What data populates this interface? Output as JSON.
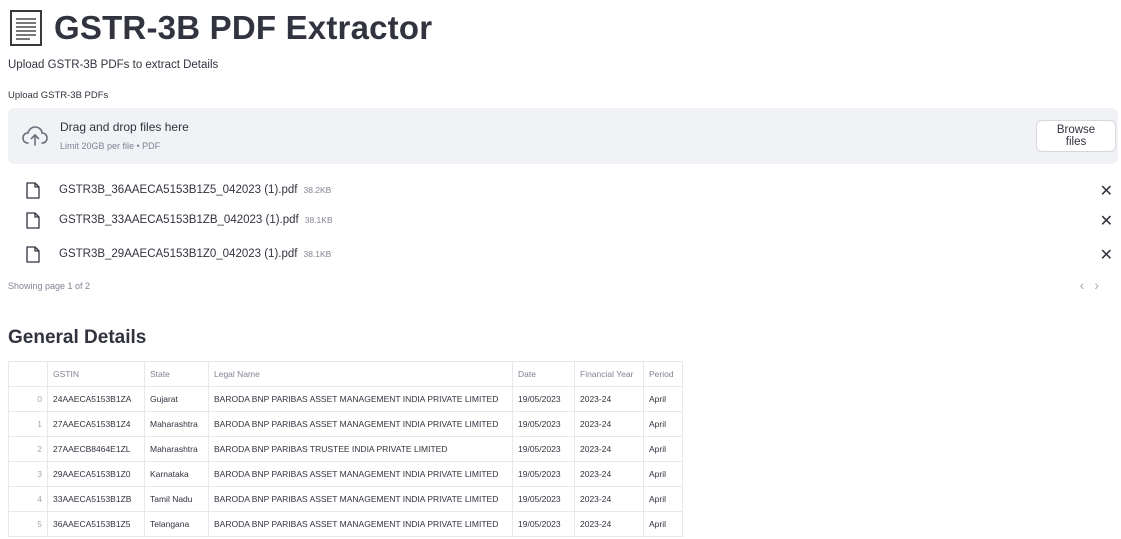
{
  "app": {
    "title": "GSTR-3B PDF Extractor",
    "subtitle": "Upload GSTR-3B PDFs to extract Details"
  },
  "upload": {
    "label": "Upload GSTR-3B PDFs",
    "drop_text": "Drag and drop files here",
    "limit_text": "Limit 20GB per file • PDF",
    "browse_label": "Browse files"
  },
  "files": [
    {
      "name": "GSTR3B_36AAECA5153B1Z5_042023 (1).pdf",
      "size": "38.2KB"
    },
    {
      "name": "GSTR3B_33AAECA5153B1ZB_042023 (1).pdf",
      "size": "38.1KB"
    },
    {
      "name": "GSTR3B_29AAECA5153B1Z0_042023 (1).pdf",
      "size": "38.1KB"
    }
  ],
  "paging": {
    "text": "Showing page 1 of 2",
    "prev": "‹",
    "next": "›"
  },
  "icons": {
    "remove": "✕"
  },
  "general": {
    "title": "General Details",
    "columns": [
      "",
      "GSTIN",
      "State",
      "Legal Name",
      "Date",
      "Financial Year",
      "Period"
    ],
    "rows": [
      [
        "0",
        "24AAECA5153B1ZA",
        "Gujarat",
        "BARODA BNP PARIBAS ASSET MANAGEMENT INDIA PRIVATE LIMITED",
        "19/05/2023",
        "2023-24",
        "April"
      ],
      [
        "1",
        "27AAECA5153B1Z4",
        "Maharashtra",
        "BARODA BNP PARIBAS ASSET MANAGEMENT INDIA PRIVATE LIMITED",
        "19/05/2023",
        "2023-24",
        "April"
      ],
      [
        "2",
        "27AAECB8464E1ZL",
        "Maharashtra",
        "BARODA BNP PARIBAS TRUSTEE INDIA PRIVATE LIMITED",
        "19/05/2023",
        "2023-24",
        "April"
      ],
      [
        "3",
        "29AAECA5153B1Z0",
        "Karnataka",
        "BARODA BNP PARIBAS ASSET MANAGEMENT INDIA PRIVATE LIMITED",
        "19/05/2023",
        "2023-24",
        "April"
      ],
      [
        "4",
        "33AAECA5153B1ZB",
        "Tamil Nadu",
        "BARODA BNP PARIBAS ASSET MANAGEMENT INDIA PRIVATE LIMITED",
        "19/05/2023",
        "2023-24",
        "April"
      ],
      [
        "5",
        "36AAECA5153B1Z5",
        "Telangana",
        "BARODA BNP PARIBAS ASSET MANAGEMENT INDIA PRIVATE LIMITED",
        "19/05/2023",
        "2023-24",
        "April"
      ]
    ]
  }
}
